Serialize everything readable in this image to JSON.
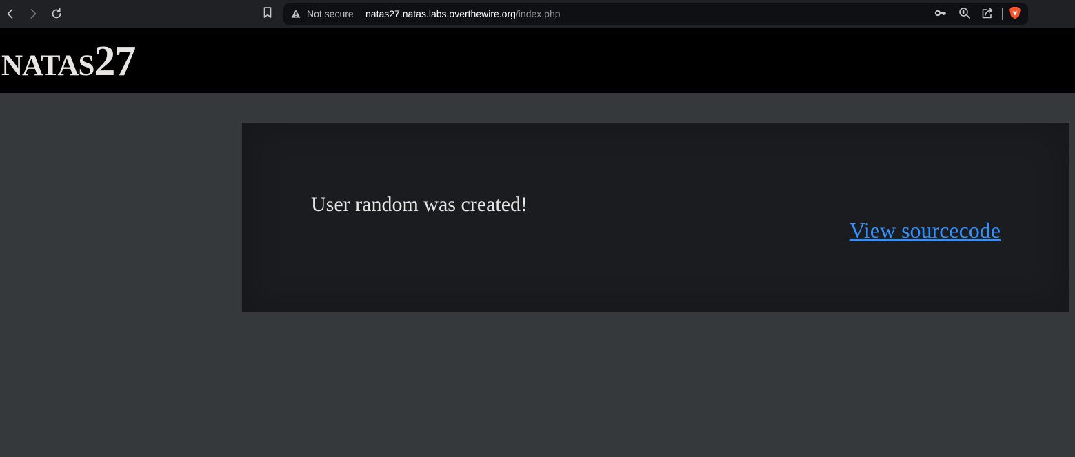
{
  "browser": {
    "security_label": "Not secure",
    "url_host": "natas27.natas.labs.overthewire.org",
    "url_path": "/index.php",
    "colors": {
      "toolbar": "#202124",
      "omnibox": "#0f1013",
      "brave_lion": "#fb542b"
    },
    "icons": [
      "back-icon",
      "forward-icon",
      "reload-icon",
      "bookmark-icon",
      "warning-icon",
      "key-icon",
      "zoom-icon",
      "share-icon",
      "brave-icon"
    ]
  },
  "header": {
    "title": "natas27"
  },
  "content": {
    "message": "User random was created!",
    "source_link": "View sourcecode",
    "colors": {
      "link": "#3391ff",
      "panel": "#1b1c1f",
      "page": "#35393c"
    }
  }
}
